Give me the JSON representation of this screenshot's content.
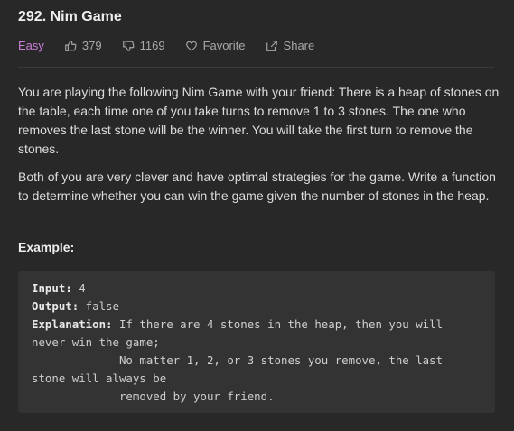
{
  "problem": {
    "title": "292. Nim Game",
    "difficulty": "Easy",
    "likes": "379",
    "dislikes": "1169",
    "favorite_label": "Favorite",
    "share_label": "Share"
  },
  "description": {
    "p1": "You are playing the following Nim Game with your friend: There is a heap of stones on the table, each time one of you take turns to remove 1 to 3 stones. The one who removes the last stone will be the winner. You will take the first turn to remove the stones.",
    "p2": "Both of you are very clever and have optimal strategies for the game. Write a function to determine whether you can win the game given the number of stones in the heap."
  },
  "example": {
    "heading": "Example:",
    "input_label": "Input:",
    "input_value": " 4",
    "output_label": "Output:",
    "output_value": " false",
    "explanation_label": "Explanation:",
    "explanation_text": " If there are 4 stones in the heap, then you will\nnever win the game;\n             No matter 1, 2, or 3 stones you remove, the last\nstone will always be\n             removed by your friend."
  },
  "colors": {
    "background": "#282828",
    "difficulty_easy": "#c77ed6"
  }
}
